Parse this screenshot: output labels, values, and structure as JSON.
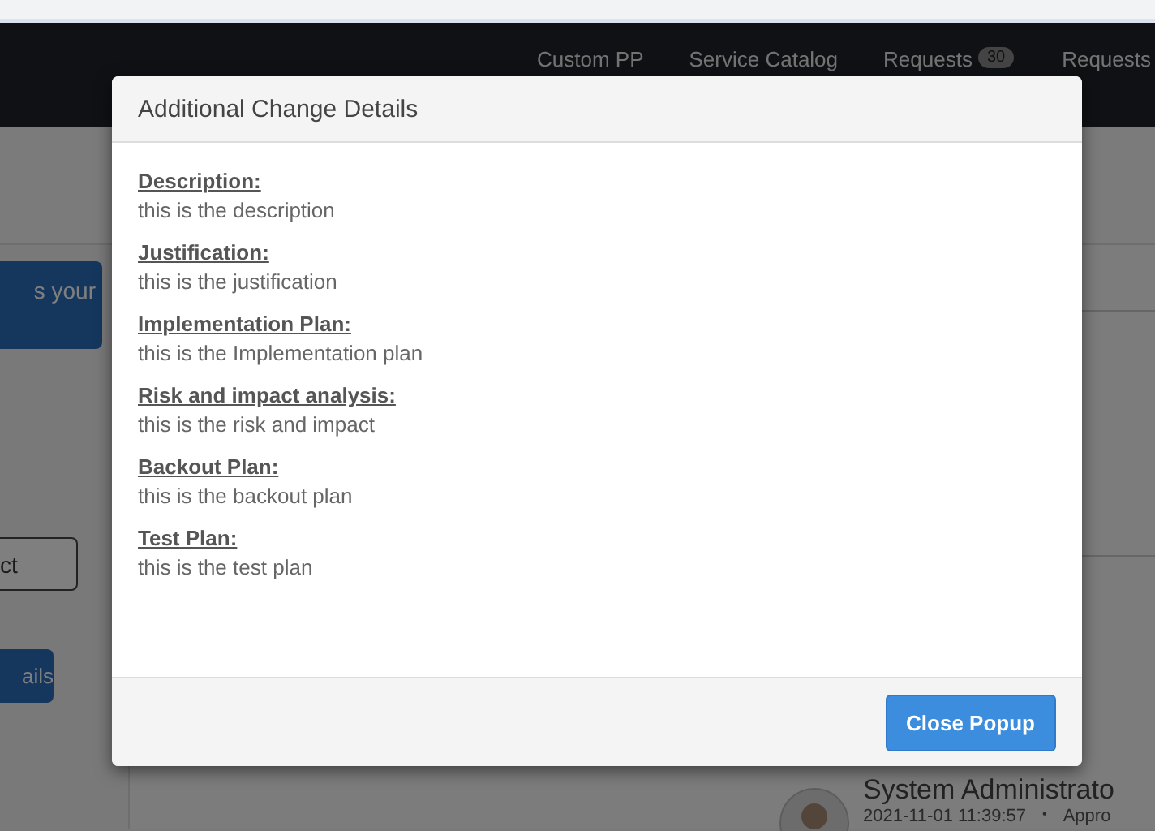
{
  "navbar": {
    "items": [
      {
        "label": "Custom PP"
      },
      {
        "label": "Service Catalog"
      },
      {
        "label": "Requests",
        "badge": "30"
      },
      {
        "label": "Requests"
      }
    ]
  },
  "left_column": {
    "notice": "s your",
    "field_value": "ct",
    "button": "ails"
  },
  "activity": {
    "author": "System Administrato",
    "timestamp": "2021-11-01 11:39:57",
    "separator": "•",
    "status": "Appro"
  },
  "modal": {
    "title": "Additional Change Details",
    "sections": [
      {
        "heading": "Description:",
        "text": "this is the description"
      },
      {
        "heading": "Justification:",
        "text": "this is the justification"
      },
      {
        "heading": "Implementation Plan:",
        "text": "this is the Implementation plan"
      },
      {
        "heading": "Risk and impact analysis:",
        "text": "this is the risk and impact"
      },
      {
        "heading": "Backout Plan:",
        "text": "this is the backout plan"
      },
      {
        "heading": "Test Plan:",
        "text": "this is the test plan"
      }
    ],
    "close_button": "Close Popup"
  }
}
